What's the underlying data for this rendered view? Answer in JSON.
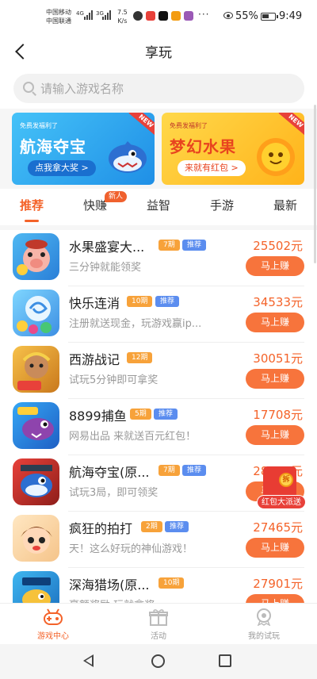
{
  "status_bar": {
    "carrier_1": "中国移动",
    "carrier_2": "中国联通",
    "net_1": "4G",
    "net_2": "3G",
    "speed_value": "7.5",
    "speed_unit": "K/s",
    "battery": "55%",
    "time": "9:49"
  },
  "header": {
    "title": "享玩"
  },
  "search": {
    "placeholder": "请输入游戏名称"
  },
  "banners": [
    {
      "subtitle": "免费发福利了",
      "title": "航海夺宝",
      "button": "点我拿大奖 >",
      "badge": "NEW"
    },
    {
      "subtitle": "免费发福利了",
      "title": "梦幻水果",
      "button": "来就有红包 >",
      "badge": "NEW"
    }
  ],
  "tabs": [
    {
      "label": "推荐",
      "active": true
    },
    {
      "label": "快赚",
      "badge": "新人"
    },
    {
      "label": "益智"
    },
    {
      "label": "手游"
    },
    {
      "label": "最新"
    }
  ],
  "games": [
    {
      "name": "水果盛宴大...",
      "period": "7期",
      "rec": "推荐",
      "desc": "三分钟就能领奖",
      "reward": "25502元",
      "button": "马上赚"
    },
    {
      "name": "快乐连消",
      "period": "10期",
      "rec": "推荐",
      "desc": "注册就送现金，玩游戏赢ip...",
      "reward": "34533元",
      "button": "马上赚"
    },
    {
      "name": "西游战记",
      "period": "12期",
      "rec": "",
      "desc": "试玩5分钟即可拿奖",
      "reward": "30051元",
      "button": "马上赚"
    },
    {
      "name": "8899捕鱼",
      "period": "5期",
      "rec": "推荐",
      "desc": "网易出品 来就送百元红包！",
      "reward": "17708元",
      "button": "马上赚"
    },
    {
      "name": "航海夺宝(原...",
      "period": "7期",
      "rec": "推荐",
      "desc": "试玩3局，即可领奖",
      "reward": "28592元",
      "button": "马上赚"
    },
    {
      "name": "疯狂的拍打",
      "period": "2期",
      "rec": "推荐",
      "desc": "天！这么好玩的神仙游戏！",
      "reward": "27465元",
      "button": "马上赚"
    },
    {
      "name": "深海猎场(原...",
      "period": "10期",
      "rec": "",
      "desc": "豪额奖励 玩就拿奖",
      "reward": "27901元",
      "button": "马上赚"
    }
  ],
  "floating": {
    "label": "红包大派送",
    "coin": "拆"
  },
  "bottom_nav": [
    {
      "label": "游戏中心",
      "active": true
    },
    {
      "label": "活动"
    },
    {
      "label": "我的试玩"
    }
  ],
  "colors": {
    "accent": "#f4632a",
    "button": "#f7743c",
    "period_tag": "#f7a23a",
    "rec_tag": "#5b8def"
  }
}
